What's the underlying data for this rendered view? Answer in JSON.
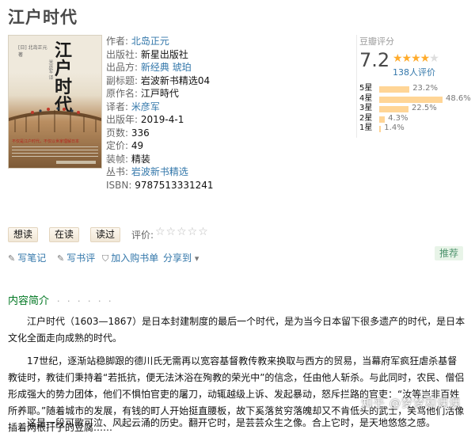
{
  "book_title": "江户时代",
  "cover": {
    "title": "江户时代",
    "author_line": "[日] 北岛正元 著",
    "translator_line": "米彦军 译",
    "tagline": "不仅是江户时代，不仅以世家理解日本"
  },
  "info": {
    "author_label": "作者:",
    "author": "北岛正元",
    "publisher_label": "出版社:",
    "publisher": "新星出版社",
    "producer_label": "出品方:",
    "producer": "新经典 琥珀",
    "subtitle_label": "副标题:",
    "subtitle": "岩波新书精选04",
    "original_label": "原作名:",
    "original": "江戸時代",
    "translator_label": "译者:",
    "translator": "米彦军",
    "year_label": "出版年:",
    "year": "2019-4-1",
    "pages_label": "页数:",
    "pages": "336",
    "price_label": "定价:",
    "price": "49",
    "binding_label": "装帧:",
    "binding": "精装",
    "series_label": "丛书:",
    "series": "岩波新书精选",
    "isbn_label": "ISBN:",
    "isbn": "9787513331241"
  },
  "rating": {
    "title": "豆瓣评分",
    "score": "7.2",
    "stars_filled": "★★★★",
    "stars_empty": "★",
    "people": "138人评价",
    "distribution": [
      {
        "label": "5星",
        "pct": "23.2%",
        "value": 23.2
      },
      {
        "label": "4星",
        "pct": "48.6%",
        "value": 48.6
      },
      {
        "label": "3星",
        "pct": "22.5%",
        "value": 22.5
      },
      {
        "label": "2星",
        "pct": "4.3%",
        "value": 4.3
      },
      {
        "label": "1星",
        "pct": "1.4%",
        "value": 1.4
      }
    ]
  },
  "actions": {
    "want": "想读",
    "reading": "在读",
    "read": "读过",
    "rate_label": "评价:",
    "rate_stars": "☆☆☆☆☆"
  },
  "toolbar": {
    "write_note": "写笔记",
    "write_review": "写书评",
    "add_cart": "加入购书单",
    "share": "分享到",
    "share_arrow": "▾",
    "recommend": "推荐"
  },
  "intro": {
    "heading": "内容简介",
    "dots": "· · · · · ·",
    "p1": "江户时代（1603—1867）是日本封建制度的最后一个时代，是为当今日本留下很多遗产的时代，是日本文化全面走向成熟的时代。",
    "p2": "17世纪，逐渐站稳脚跟的德川氏无需再以宽容基督教传教来换取与西方的贸易，当幕府军疯狂虐杀基督教徒时，教徒们秉持着“若抵抗，便无法沐浴在殉教的荣光中”的信念，任由他人斩杀。与此同时，农民、僧侣形成强大的势力团体，他们不惧怕官吏的屠刀，动辄越级上诉、发起暴动，怒斥拦路的官吏：“汝等岂非百姓所养耶。”随着城市的发展，有钱的町人开始挺直腰板，故下奚落贫穷落魄却又不肯低头的武士，笑骂他们活像插着两根扦子的豆腐……",
    "p3": "这是一段可歌可泣、风起云涌的历史。翻开它时，是芸芸众生之像。合上它时，是天地悠悠之感。"
  },
  "watermark": "知乎 @梦梦和课课"
}
